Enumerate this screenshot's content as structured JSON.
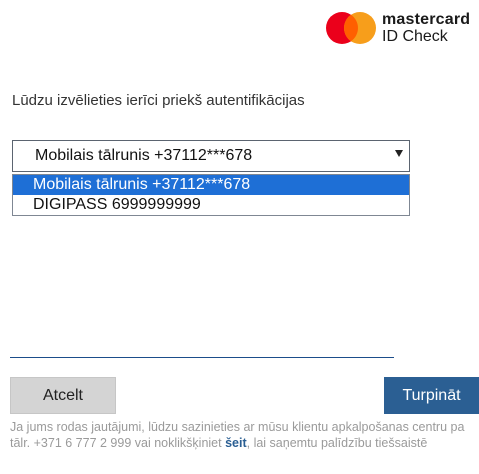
{
  "brand": {
    "logo_icon": "mastercard-circles-icon",
    "word": "mastercard",
    "sub": "ID Check",
    "colors": {
      "red": "#eb001b",
      "orange": "#f79e1b",
      "overlap": "#ff5f00"
    }
  },
  "prompt": "Lūdzu izvēlieties ierīci priekš autentifikācijas",
  "device_select": {
    "value": "Mobilais tālrunis +37112***678",
    "options": [
      {
        "label": "Mobilais tālrunis +37112***678",
        "highlighted": true
      },
      {
        "label": "DIGIPASS 6999999999",
        "highlighted": false
      }
    ]
  },
  "buttons": {
    "cancel": "Atcelt",
    "continue": "Turpināt"
  },
  "help": {
    "text_before": "Ja jums rodas jautājumi, lūdzu sazinieties ar mūsu klientu apkalpošanas centru pa tālr. +371 6 777 2 999 vai noklikšķiniet ",
    "link": "šeit",
    "text_after": ", lai saņemtu palīdzību tiešsaistē"
  },
  "colors": {
    "accent": "#2b5f93",
    "highlight": "#1e6fd6"
  }
}
